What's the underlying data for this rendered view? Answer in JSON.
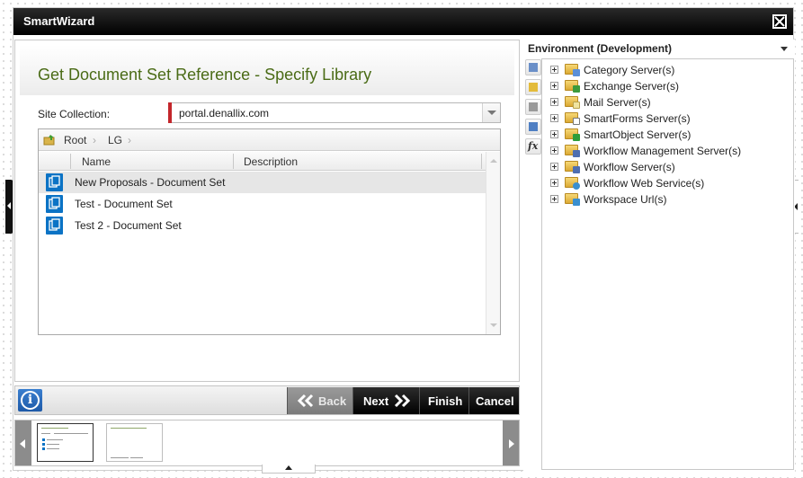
{
  "window": {
    "title": "SmartWizard"
  },
  "wizard": {
    "heading": "Get Document Set Reference - Specify Library",
    "site_collection": {
      "label": "Site Collection:",
      "value": "portal.denallix.com"
    },
    "breadcrumb": [
      "Root",
      "LG"
    ],
    "columns": [
      "Name",
      "Description"
    ],
    "rows": [
      {
        "name": "New Proposals - Document Set",
        "description": "",
        "selected": true
      },
      {
        "name": "Test - Document Set",
        "description": "",
        "selected": false
      },
      {
        "name": "Test 2 - Document Set",
        "description": "",
        "selected": false
      }
    ]
  },
  "buttons": {
    "info": "i",
    "back": "Back",
    "next": "Next",
    "finish": "Finish",
    "cancel": "Cancel"
  },
  "environment": {
    "title": "Environment (Development)",
    "items": [
      {
        "label": "Category Server(s)",
        "icon": "category-server-icon",
        "badge": "#5a8fd8"
      },
      {
        "label": "Exchange Server(s)",
        "icon": "exchange-server-icon",
        "badge": "#3c9a3c"
      },
      {
        "label": "Mail Server(s)",
        "icon": "mail-server-icon",
        "badge": "#f0e4a0"
      },
      {
        "label": "SmartForms Server(s)",
        "icon": "smartforms-server-icon",
        "badge": "#ffffff"
      },
      {
        "label": "SmartObject Server(s)",
        "icon": "smartobject-server-icon",
        "badge": "#2e9d3a"
      },
      {
        "label": "Workflow Management Server(s)",
        "icon": "workflow-management-server-icon",
        "badge": "#4f6fb0"
      },
      {
        "label": "Workflow Server(s)",
        "icon": "workflow-server-icon",
        "badge": "#4f6fb0"
      },
      {
        "label": "Workflow Web Service(s)",
        "icon": "workflow-web-service-icon",
        "badge": "#3a8fcf"
      },
      {
        "label": "Workspace Url(s)",
        "icon": "workspace-url-icon",
        "badge": "#3a8fcf"
      }
    ]
  },
  "colors": {
    "heading": "#4a6b16",
    "required_marker": "#c3262b",
    "document_set_icon": "#0b73c5",
    "titlebar": "#000000"
  }
}
